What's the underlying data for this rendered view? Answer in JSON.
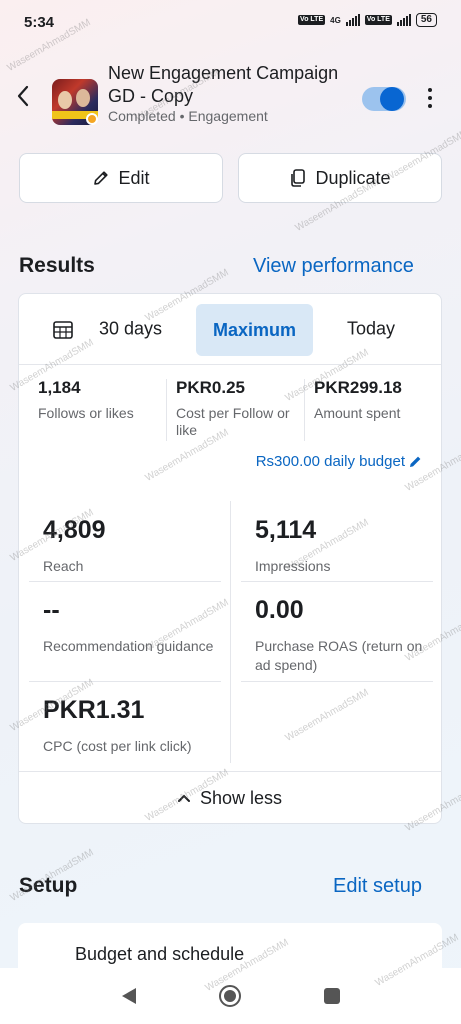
{
  "status_bar": {
    "time": "5:34",
    "network": "4G",
    "volte1": "Vo LTE",
    "volte2": "Vo LTE",
    "battery": "56"
  },
  "header": {
    "title_line1": "New Engagement Campaign",
    "title_line2": "GD - Copy",
    "subtitle": "Completed • Engagement",
    "toggle_on": true
  },
  "actions": {
    "edit_label": "Edit",
    "duplicate_label": "Duplicate"
  },
  "results": {
    "title": "Results",
    "link": "View performance",
    "tabs": {
      "days": "30 days",
      "maximum": "Maximum",
      "today": "Today",
      "selected": "Maximum"
    },
    "top_stats": [
      {
        "value": "1,184",
        "label": "Follows or likes"
      },
      {
        "value": "PKR0.25",
        "label": "Cost per Follow or like"
      },
      {
        "value": "PKR299.18",
        "label": "Amount spent"
      }
    ],
    "budget": "Rs300.00 daily budget",
    "metrics": {
      "reach": {
        "value": "4,809",
        "label": "Reach"
      },
      "impressions": {
        "value": "5,114",
        "label": "Impressions"
      },
      "recommendation": {
        "value": "--",
        "label": "Recommendation guidance"
      },
      "roas": {
        "value": "0.00",
        "label": "Purchase ROAS (return on ad spend)"
      },
      "cpc": {
        "value": "PKR1.31",
        "label": "CPC (cost per link click)"
      }
    },
    "show_less": "Show less"
  },
  "setup": {
    "title": "Setup",
    "link": "Edit setup",
    "budget_item": "Budget and schedule"
  },
  "watermark": "WaseemAhmadSMM",
  "colors": {
    "accent": "#0a66c2",
    "toggle_knob": "#0866d2",
    "status": "#f5a623"
  }
}
